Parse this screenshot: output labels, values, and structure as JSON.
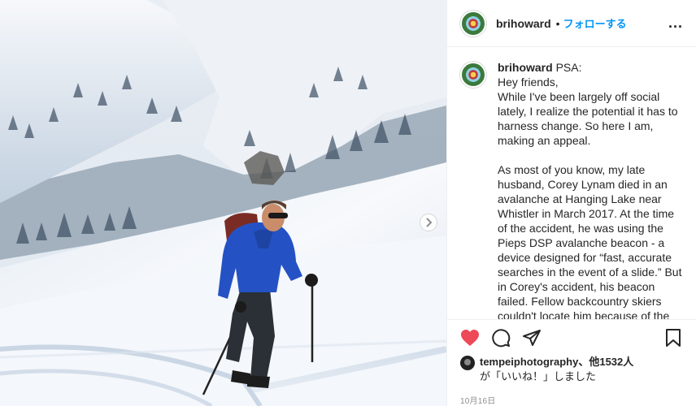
{
  "post": {
    "username": "brihoward",
    "follow_label": "フォローする",
    "dot": "•",
    "more_label": "...",
    "caption_username": "brihoward",
    "caption_text": "PSA:\nHey friends,\nWhile I've been largely off social lately, I realize the potential it has to harness change. So here I am, making an appeal.\n\nAs most of you know, my late husband, Corey Lynam died in an avalanche at Hanging Lake near Whistler in March 2017. At the time of the accident, he was using the Pieps DSP avalanche beacon - a device designed for “fast, accurate searches in the event of a slide.” But in Corey's accident, his beacon failed. Fellow backcountry skiers couldn't locate him because of the fundamental design flaw which turned the beacon into the wrong mode",
    "likes_user": "tempeiphotography",
    "likes_count_text": "、他1532人",
    "likes_suffix": "が「いいね！」しました",
    "date": "10月16日"
  },
  "icons": {
    "like": "heart-icon",
    "comment": "comment-icon",
    "share": "paper-plane-icon",
    "save": "bookmark-icon",
    "next": "chevron-right-icon"
  },
  "colors": {
    "like": "#ed4956",
    "follow": "#0095f6",
    "jacket": "#2452c4"
  }
}
